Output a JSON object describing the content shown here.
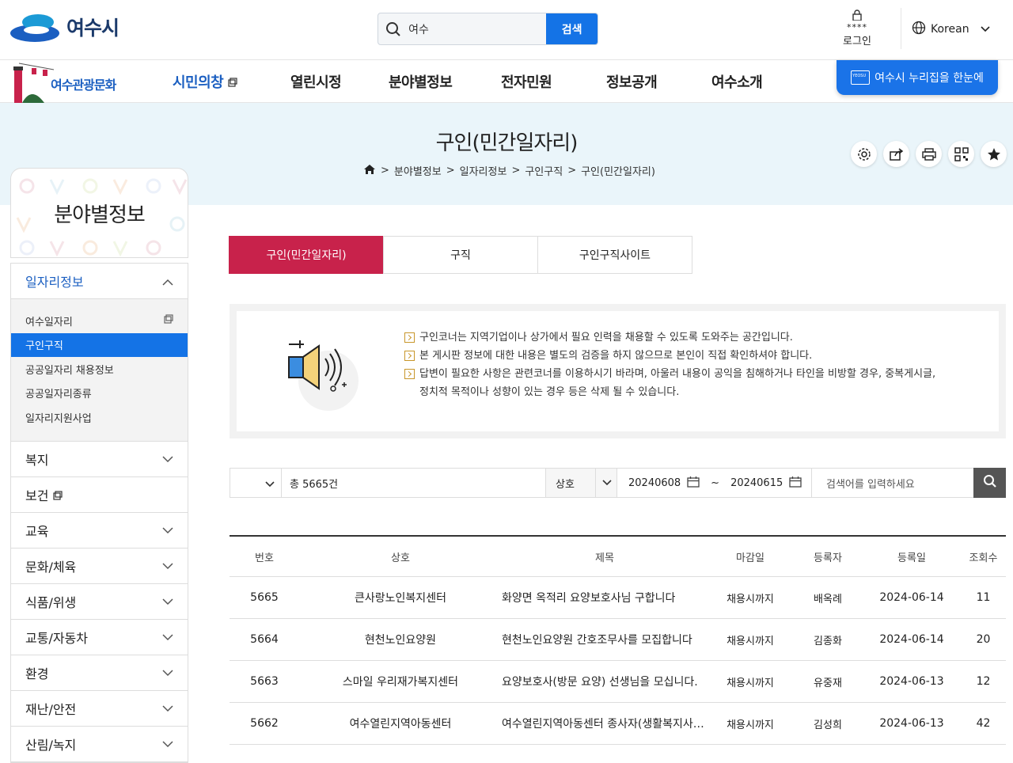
{
  "header": {
    "logo_text": "여수시",
    "search_value": "여수",
    "search_button": "검색",
    "login_stars": "****",
    "login_label": "로그인",
    "language": "Korean"
  },
  "nav": {
    "tour_label": "여수관광문화",
    "items": [
      "시민의창",
      "열린시정",
      "분야별정보",
      "전자민원",
      "정보공개",
      "여수소개"
    ],
    "cta_badge": "YEOSU",
    "cta_label": "여수시 누리집을 한눈에"
  },
  "hero": {
    "title": "구인(민간일자리)",
    "breadcrumb": [
      "분야별정보",
      "일자리정보",
      "구인구직",
      "구인(민간일자리)"
    ]
  },
  "sidebar": {
    "title": "분야별정보",
    "open_section": "일자리정보",
    "sub_items": [
      "여수일자리",
      "구인구직",
      "공공일자리 채용정보",
      "공공일자리종류",
      "일자리지원사업"
    ],
    "sections": [
      "복지",
      "보건",
      "교육",
      "문화/체육",
      "식품/위생",
      "교통/자동차",
      "환경",
      "재난/안전",
      "산림/녹지"
    ]
  },
  "tabs": [
    "구인(민간일자리)",
    "구직",
    "구인구직사이트"
  ],
  "notice": [
    "구인코너는 지역기업이나 상가에서 필요 인력을 채용할 수 있도록 도와주는 공간입니다.",
    "본 게시판 정보에 대한 내용은 별도의 검증을 하지 않으므로 본인이 직접 확인하셔야 합니다.",
    "답변이 필요한 사항은 관련코너를 이용하시기 바라며, 아울러 내용이 공익을 침해하거나 타인을 비방할 경우, 중복게시글,",
    "정치적 목적이나 성향이 있는 경우 등은 삭제 될 수 있습니다."
  ],
  "filter": {
    "total": "총 5665건",
    "type": "상호",
    "date_from": "20240608",
    "date_sep": "~",
    "date_to": "20240615",
    "keyword_placeholder": "검색어를 입력하세요"
  },
  "table": {
    "headers": [
      "번호",
      "상호",
      "제목",
      "마감일",
      "등록자",
      "등록일",
      "조회수"
    ],
    "rows": [
      [
        "5665",
        "큰사랑노인복지센터",
        "화양면 옥적리 요양보호사님 구합니다",
        "채용시까지",
        "배옥례",
        "2024-06-14",
        "11"
      ],
      [
        "5664",
        "현천노인요양원",
        "현천노인요양원 간호조무사를 모집합니다",
        "채용시까지",
        "김종화",
        "2024-06-14",
        "20"
      ],
      [
        "5663",
        "스마일 우리재가복지센터",
        "요양보호사(방문 요양) 선생님을 모십니다.",
        "채용시까지",
        "유중재",
        "2024-06-13",
        "12"
      ],
      [
        "5662",
        "여수열린지역아동센터",
        "여수열린지역아동센터 종사자(생활복지사) 채용 공고",
        "채용시까지",
        "김성희",
        "2024-06-13",
        "42"
      ]
    ]
  },
  "colors": {
    "primary_blue": "#1473e6",
    "accent_red": "#c8224b",
    "hero_bg": "#eaf5fa"
  }
}
